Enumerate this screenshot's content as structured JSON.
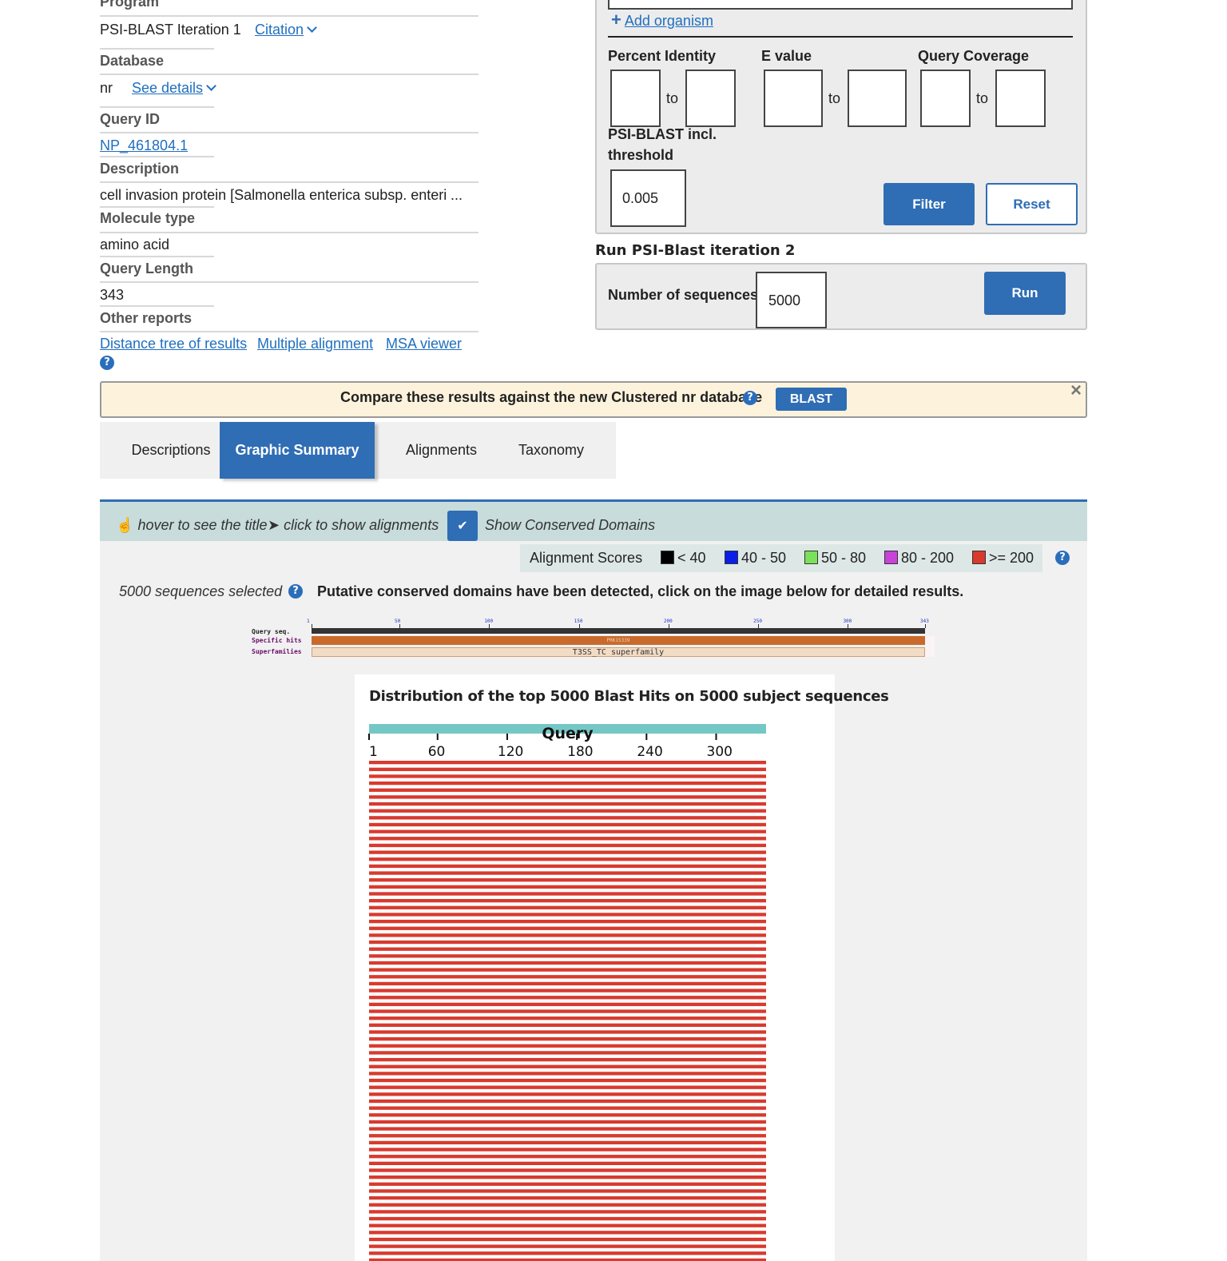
{
  "summary": {
    "program_label": "Program",
    "program_value": "PSI-BLAST Iteration 1",
    "citation_link": "Citation",
    "database_label": "Database",
    "database_value": "nr",
    "see_details_link": "See details",
    "query_id_label": "Query ID",
    "query_id_value": "NP_461804.1",
    "description_label": "Description",
    "description_value": "cell invasion protein [Salmonella enterica subsp. enteri",
    "description_ellipsis": "...",
    "molecule_type_label": "Molecule type",
    "molecule_type_value": "amino acid",
    "query_length_label": "Query Length",
    "query_length_value": "343",
    "other_reports_label": "Other reports",
    "other_reports_links": [
      "Distance tree of results",
      "Multiple alignment",
      "MSA viewer"
    ]
  },
  "filter": {
    "add_organism": "Add organism",
    "percent_identity_label": "Percent Identity",
    "evalue_label": "E value",
    "query_coverage_label": "Query Coverage",
    "to_label": "to",
    "psiblast_threshold_label_1": "PSI-BLAST incl.",
    "psiblast_threshold_label_2": "threshold",
    "psiblast_threshold_value": "0.005",
    "filter_button": "Filter",
    "reset_button": "Reset"
  },
  "iteration": {
    "title": "Run PSI-Blast iteration 2",
    "num_sequences_label": "Number of sequences",
    "num_sequences_value": "5000",
    "run_button": "Run"
  },
  "banner": {
    "text": "Compare these results against the new Clustered nr database",
    "blast_button": "BLAST",
    "close_glyph": "×"
  },
  "tabs": [
    "Descriptions",
    "Graphic Summary",
    "Alignments",
    "Taxonomy"
  ],
  "active_tab": 1,
  "toolbar": {
    "hover_hint": "hover to see the title",
    "click_hint": "click to show alignments",
    "conserved_domains_label": "Show Conserved Domains"
  },
  "legend": {
    "title": "Alignment Scores",
    "items": [
      {
        "label": "< 40",
        "color": "#000000"
      },
      {
        "label": "40 - 50",
        "color": "#0a1ee8"
      },
      {
        "label": "50 - 80",
        "color": "#7be05a"
      },
      {
        "label": "80 - 200",
        "color": "#c843d8"
      },
      {
        "label": ">= 200",
        "color": "#d83a2e"
      }
    ]
  },
  "sequences_selected": "5000 sequences selected",
  "cdd_message": "Putative conserved domains have been detected, click on the image below for detailed results.",
  "cdd": {
    "row_labels": [
      "Query seq.",
      "Specific hits",
      "Superfamilies"
    ],
    "tick_labels": [
      "1",
      "50",
      "100",
      "150",
      "200",
      "250",
      "300",
      "343"
    ],
    "specific_hit": "PRK15339",
    "superfamily": "T3SS_TC superfamily"
  },
  "chart_data": {
    "type": "bar",
    "title": "Distribution of the top 5000 Blast Hits on 5000 subject sequences",
    "query_label": "Query",
    "axis_ticks": [
      1,
      60,
      120,
      180,
      240,
      300
    ],
    "query_length": 343,
    "score_bin": ">= 200",
    "hit_color": "#d83a2e",
    "visible_hit_rows": 76
  },
  "colors": {
    "accent": "#2f6db5",
    "banner_bg": "#fdf3dc",
    "toolbar_bg": "#c7dcdb",
    "query_bar": "#75c7c6"
  }
}
